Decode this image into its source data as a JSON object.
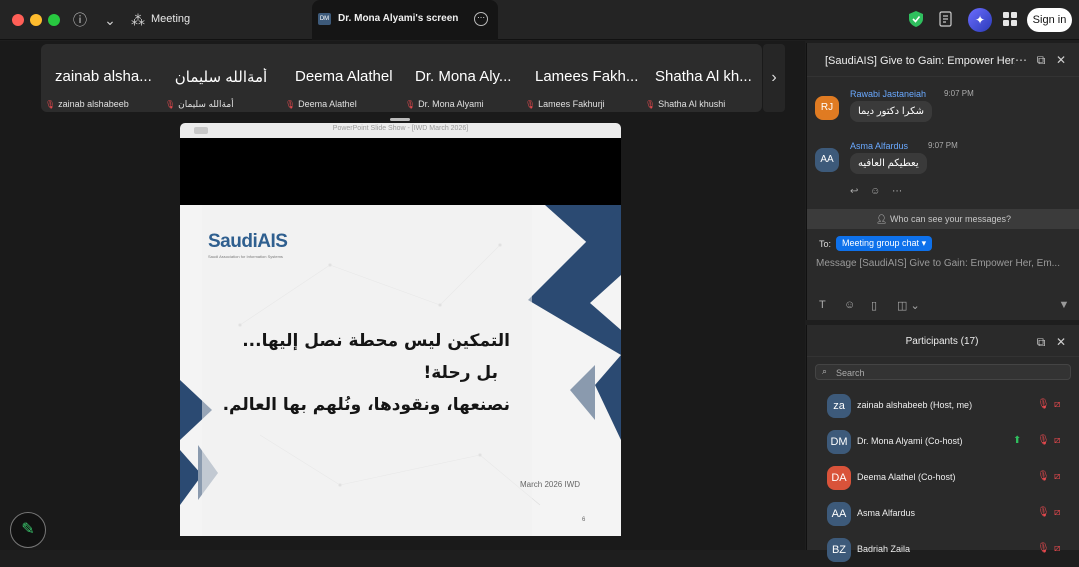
{
  "toolbar": {
    "meeting_label": "Meeting",
    "share_tab_title": "Dr. Mona Alyami's screen",
    "share_tab_initials": "DM",
    "signin_label": "Sign in"
  },
  "strip": {
    "tiles": [
      {
        "name": "zainab alsha...",
        "sub": "zainab alshabeeb"
      },
      {
        "name": "أمةالله سليمان",
        "sub": "أمةالله سليمان"
      },
      {
        "name": "Deema Alathel",
        "sub": "Deema Alathel"
      },
      {
        "name": "Dr. Mona Aly...",
        "sub": "Dr. Mona Alyami"
      },
      {
        "name": "Lamees Fakh...",
        "sub": "Lamees Fakhurji"
      },
      {
        "name": "Shatha Al kh...",
        "sub": "Shatha Al khushi"
      }
    ]
  },
  "slide_window": {
    "title": "PowerPoint Slide Show - [IWD March 2026]",
    "logo_main": "SaudiAIS",
    "logo_sub": "Saudi Association for Information Systems",
    "line1": "التمكين ليس محطة نصل إليها...",
    "line2": "بل رحلة!",
    "line3": "نصنعها، ونقودها، ونُلهم بها العالم.",
    "footer": "March 2026 IWD",
    "page_number": "6"
  },
  "chat": {
    "title": "[SaudiAIS] Give to Gain: Empower Her,...",
    "messages": [
      {
        "initials": "RJ",
        "name": "Rawabi Jastaneiah",
        "time": "9:07 PM",
        "text": "شكرا دكتور ديما",
        "color": "#e07b22"
      },
      {
        "initials": "AA",
        "name": "Asma Alfardus",
        "time": "9:07 PM",
        "text": "يعطيكم العافيه",
        "color": "#3d5a7a"
      }
    ],
    "who_can_see": "Who can see your messages?",
    "to_label": "To:",
    "to_value": "Meeting group chat",
    "input_placeholder": "Message [SaudiAIS] Give to Gain: Empower Her, Em..."
  },
  "participants": {
    "title": "Participants (17)",
    "search_placeholder": "Search",
    "list": [
      {
        "initials": "za",
        "name": "zainab alshabeeb (Host, me)",
        "color": "#3d5a7a",
        "sharing": false
      },
      {
        "initials": "DM",
        "name": "Dr. Mona Alyami (Co-host)",
        "color": "#3d5a7a",
        "sharing": true
      },
      {
        "initials": "DA",
        "name": "Deema Alathel (Co-host)",
        "color": "#d9533a",
        "sharing": false
      },
      {
        "initials": "AA",
        "name": "Asma Alfardus",
        "color": "#3d5a7a",
        "sharing": false
      },
      {
        "initials": "BZ",
        "name": "Badriah Zaila",
        "color": "#3d5a7a",
        "sharing": false
      }
    ]
  }
}
